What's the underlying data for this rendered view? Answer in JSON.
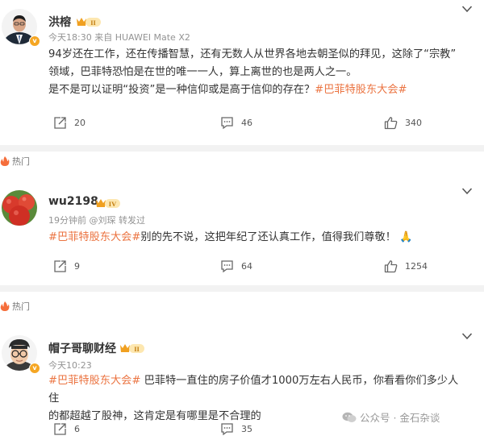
{
  "comments": [
    {
      "username": "洪榕",
      "level": "II",
      "meta": "今天18:30 来自 HUAWEI Mate X2",
      "content_lines": [
        "94岁还在工作，还在传播智慧，还有无数人从世界各地去朝圣似的拜见，这除了“宗教”",
        "领域，巴菲特恐怕是在世的唯一一人，算上离世的也是两人之一。"
      ],
      "content_line3_plain": "是不是可以证明“投资”是一种信仰或是高于信仰的存在？",
      "content_line3_tag": "#巴菲特股东大会#",
      "reposts": "20",
      "comments": "46",
      "likes": "340"
    },
    {
      "hot_label": "热门",
      "username": "wu2198",
      "level": "IV",
      "meta": "19分钟前 @刘琛 转发过",
      "content_tag": "#巴菲特股东大会#",
      "content_plain": "别的先不说，这把年纪了还认真工作，值得我们尊敬！",
      "emoji": "🙏",
      "reposts": "9",
      "comments": "64",
      "likes": "1254"
    },
    {
      "hot_label": "热门",
      "username": "帽子哥聊财经",
      "level": "II",
      "meta": "今天10:23",
      "content_tag": "#巴菲特股东大会#",
      "content_line1_plain": " 巴菲特一直住的房子价值才1000万左右人民币，你看看你们多少人住",
      "content_line2": "的都超越了股神，这肯定是有哪里是不合理的",
      "reposts": "6",
      "comments": "35"
    }
  ],
  "watermark": "公众号 · 金石杂谈",
  "colors": {
    "tag": "#eb7340",
    "meta": "#939393",
    "separator": "#f2f2f2",
    "vbadge": "#f5a623"
  }
}
